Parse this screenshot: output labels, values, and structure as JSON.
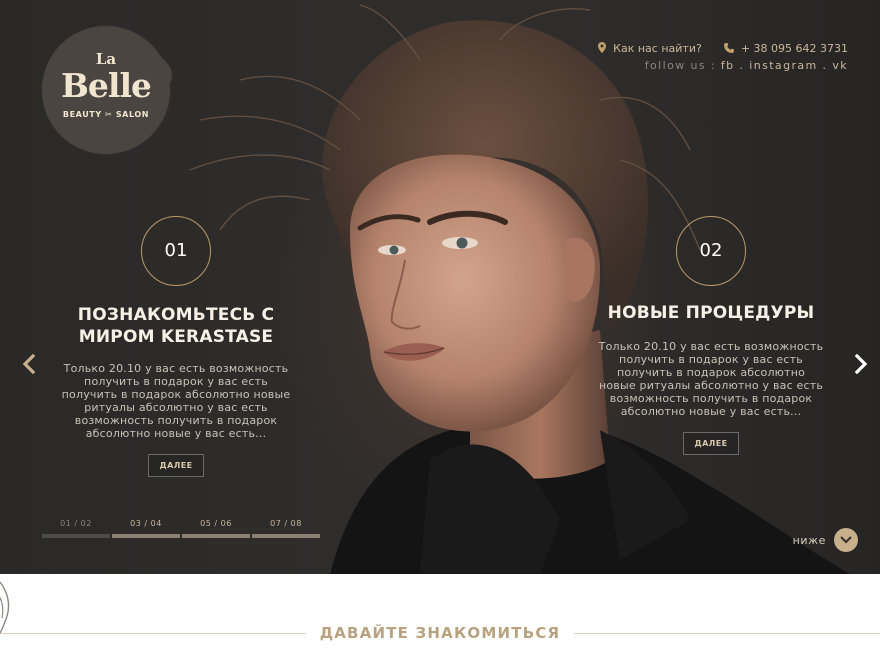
{
  "logo": {
    "la": "La",
    "belle": "Belle",
    "subtitle": "BEAUTY ✂ SALON"
  },
  "contacts": {
    "find_us": "Как нас найти?",
    "phone": "+ 38 095 642 3731",
    "follow_prefix": "follow us :",
    "socials": "fb . instagram . vk"
  },
  "slides": [
    {
      "number": "01",
      "title_line1": "ПОЗНАКОМЬТЕСЬ С",
      "title_line2": "МИРОМ KERASTASE",
      "text": "Только 20.10 у вас есть возможность получить в подарок у вас есть получить в подарок абсолютно новые ритуалы абсолютно у вас есть возможность получить в подарок абсолютно новые у вас есть...",
      "button": "ДАЛЕЕ"
    },
    {
      "number": "02",
      "title_line1": "НОВЫЕ ПРОЦЕДУРЫ",
      "title_line2": "",
      "text": "Только 20.10 у вас есть возможность получить в подарок у вас есть получить в подарок абсолютно новые ритуалы абсолютно у вас есть возможность получить в подарок абсолютно новые у вас есть...",
      "button": "ДАЛЕЕ"
    }
  ],
  "pager": [
    {
      "label": "01 / 02",
      "active": true
    },
    {
      "label": "03 / 04",
      "active": false
    },
    {
      "label": "05 / 06",
      "active": false
    },
    {
      "label": "07 / 08",
      "active": false
    }
  ],
  "scroll_down": "ниже",
  "section_heading": "ДАВАЙТЕ ЗНАКОМИТЬСЯ",
  "colors": {
    "accent": "#c7b08a",
    "gold_line": "#b99a64",
    "dark_bg": "#2d2c2b"
  },
  "icons": {
    "location": "location-pin-icon",
    "phone": "phone-icon",
    "prev": "chevron-left-icon",
    "next": "chevron-right-icon",
    "down": "chevron-down-icon"
  }
}
